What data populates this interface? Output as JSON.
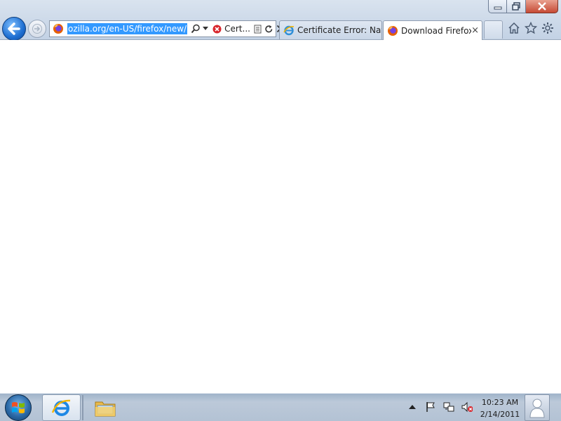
{
  "window": {
    "caption": {
      "minimize_label": "Minimize",
      "restore_label": "Restore Down",
      "close_label": "Close"
    }
  },
  "navigation": {
    "back_icon": "back-arrow-icon",
    "forward_icon": "forward-arrow-icon"
  },
  "address_bar": {
    "url": "ozilla.org/en-US/firefox/new/",
    "security_text": "Cert...",
    "site_icon": "firefox-icon"
  },
  "tabs": [
    {
      "label": "Certificate Error: Nav...",
      "icon": "ie-page-icon",
      "active": false
    },
    {
      "label": "Download Firefox...",
      "icon": "firefox-icon",
      "active": true,
      "close": "×"
    }
  ],
  "taskbar": {
    "pinned": [
      "internet-explorer-icon",
      "windows-explorer-icon"
    ],
    "clock_time": "10:23 AM",
    "clock_date": "2/14/2011",
    "tray_icons": [
      "show-hidden-icons",
      "action-center-flag-icon",
      "network-icon",
      "volume-muted-icon"
    ]
  },
  "colors": {
    "selection": "#3399ff",
    "chrome_top": "#d9e3ef",
    "close_button": "#c64a35",
    "taskbar": "#b3c2d4"
  }
}
